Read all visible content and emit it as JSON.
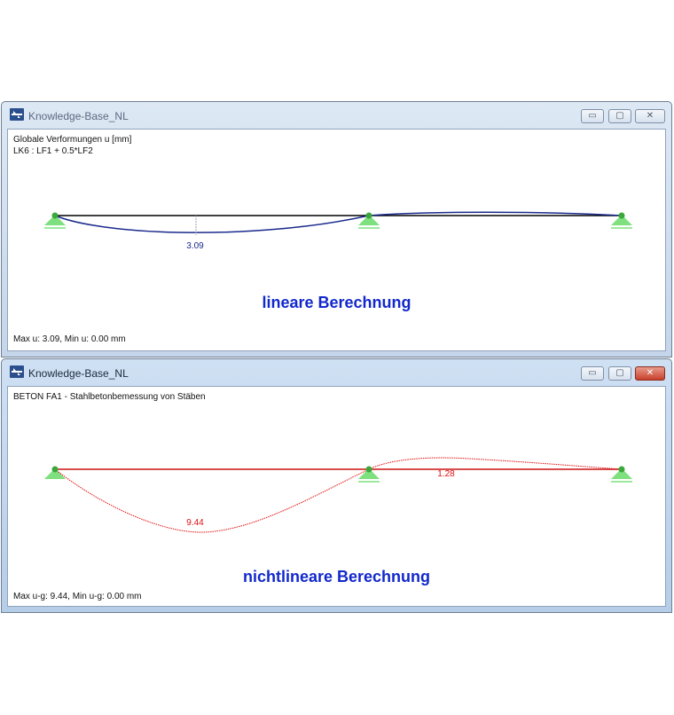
{
  "windows": [
    {
      "title": "Knowledge-Base_NL",
      "header": [
        "Globale Verformungen u [mm]",
        "LK6 : LF1 + 0.5*LF2"
      ],
      "value_label": "3.09",
      "method_label": "lineare Berechnung",
      "footer": "Max u: 3.09, Min u: 0.00 mm",
      "deflection_color": "#1a2a8c",
      "beam_color": "#000000"
    },
    {
      "title": "Knowledge-Base_NL",
      "header": [
        "BETON FA1 - Stahlbetonbemessung von Stäben"
      ],
      "value_labels": [
        "9.44",
        "1.28"
      ],
      "method_label": "nichtlineare Berechnung",
      "footer": "Max u-g: 9.44, Min u-g: 0.00 mm",
      "deflection_color": "#e01010",
      "beam_color": "#cc1010"
    }
  ],
  "controls": {
    "minimize": "▭",
    "maximize": "▢",
    "close": "✕"
  },
  "support_color": "#7ee07e",
  "node_color": "#3aa83a"
}
